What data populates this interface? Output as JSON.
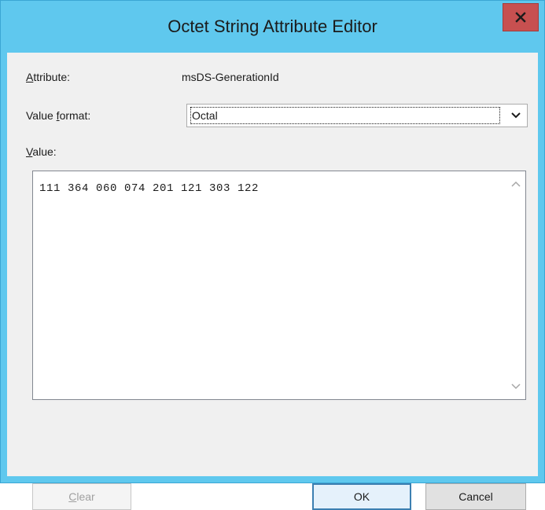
{
  "window": {
    "title": "Octet String Attribute Editor",
    "close_glyph": "close-icon"
  },
  "attribute": {
    "label_prefix": "A",
    "label_rest": "ttribute:",
    "value": "msDS-GenerationId"
  },
  "value_format": {
    "label_before": "Value ",
    "label_ul": "f",
    "label_after": "ormat:",
    "selected": "Octal"
  },
  "value": {
    "label_ul": "V",
    "label_rest": "alue:",
    "text": "111 364 060 074 201 121 303 122"
  },
  "buttons": {
    "clear_ul": "C",
    "clear_rest": "lear",
    "clear_enabled": false,
    "ok": "OK",
    "cancel": "Cancel"
  },
  "colors": {
    "titlebar": "#5fc8ee",
    "close": "#c75050",
    "client": "#f0f0f0",
    "default_button_border": "#3c7fb1"
  }
}
